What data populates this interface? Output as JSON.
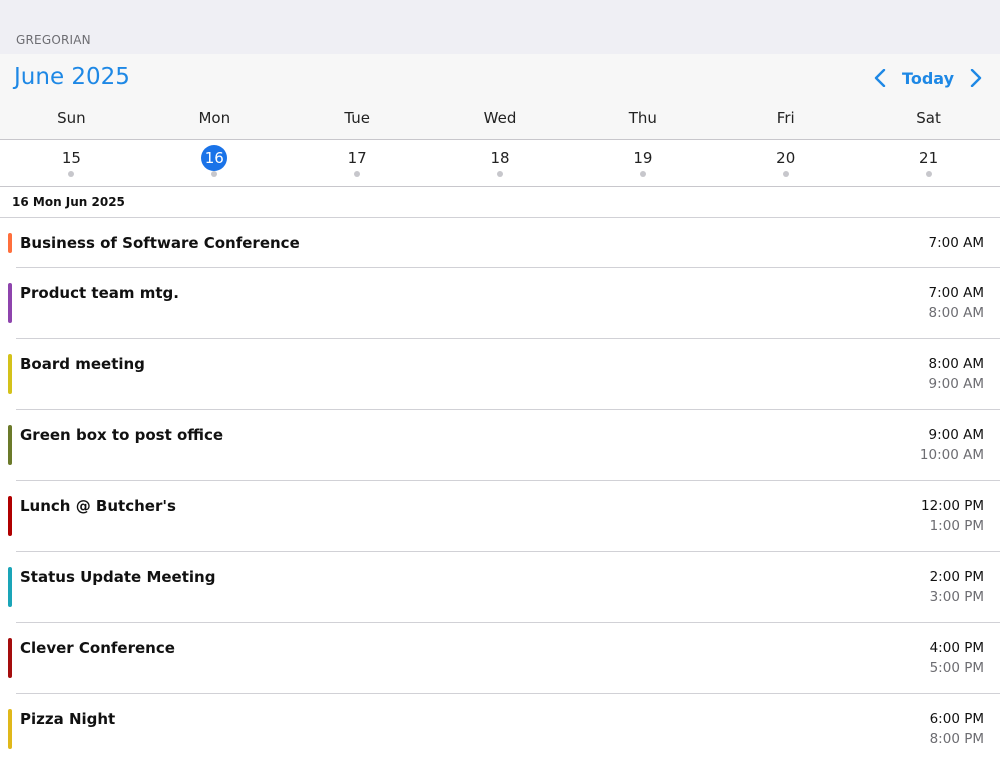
{
  "calendar_type": "GREGORIAN",
  "header": {
    "month_title": "June 2025",
    "today_label": "Today",
    "prev_icon": "chevron-left-icon",
    "next_icon": "chevron-right-icon",
    "accent_color": "#1e88e5"
  },
  "week": {
    "days_of_week": [
      "Sun",
      "Mon",
      "Tue",
      "Wed",
      "Thu",
      "Fri",
      "Sat"
    ],
    "dates": [
      "15",
      "16",
      "17",
      "18",
      "19",
      "20",
      "21"
    ],
    "selected_date": "16"
  },
  "day_heading": "16 Mon Jun 2025",
  "events": [
    {
      "title": "Business of Software Conference",
      "start": "7:00 AM",
      "end": "",
      "color": "#ff6f3c"
    },
    {
      "title": "Product team mtg.",
      "start": "7:00 AM",
      "end": "8:00 AM",
      "color": "#8e44ad"
    },
    {
      "title": "Board meeting",
      "start": "8:00 AM",
      "end": "9:00 AM",
      "color": "#d4c21a"
    },
    {
      "title": "Green box to post office",
      "start": "9:00 AM",
      "end": "10:00 AM",
      "color": "#6b7a2a"
    },
    {
      "title": "Lunch @ Butcher's",
      "start": "12:00 PM",
      "end": "1:00 PM",
      "color": "#b00000"
    },
    {
      "title": "Status Update Meeting",
      "start": "2:00 PM",
      "end": "3:00 PM",
      "color": "#1aa5b8"
    },
    {
      "title": "Clever Conference",
      "start": "4:00 PM",
      "end": "5:00 PM",
      "color": "#a50d0d"
    },
    {
      "title": "Pizza Night",
      "start": "6:00 PM",
      "end": "8:00 PM",
      "color": "#e0b81a"
    }
  ]
}
